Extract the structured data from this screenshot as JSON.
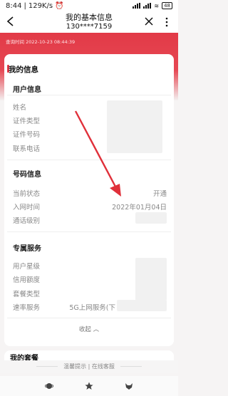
{
  "status_bar": {
    "time": "8:44",
    "speed": "129K/s",
    "battery": "48"
  },
  "header": {
    "title": "我的基本信息",
    "subtitle": "130****7159"
  },
  "query_time": "查询时间 2022-10-23 08:44:39",
  "section": {
    "title": "我的信息"
  },
  "user_info": {
    "heading": "用户信息",
    "rows": [
      {
        "label": "姓名"
      },
      {
        "label": "证件类型"
      },
      {
        "label": "证件号码"
      },
      {
        "label": "联系电话"
      }
    ]
  },
  "number_info": {
    "heading": "号码信息",
    "rows": [
      {
        "label": "当前状态",
        "value": "开通"
      },
      {
        "label": "入网时间",
        "value": "2022年01月04日"
      },
      {
        "label": "通话级别",
        "value": ""
      }
    ]
  },
  "service": {
    "heading": "专属服务",
    "rows": [
      {
        "label": "用户星级",
        "value": ""
      },
      {
        "label": "信用额度",
        "value": ""
      },
      {
        "label": "套餐类型",
        "value": ""
      },
      {
        "label": "速率服务",
        "value": "5G上网服务(下"
      }
    ]
  },
  "collapse_label": "收起",
  "next_section": {
    "title": "我的套餐"
  },
  "bottom_links": {
    "tips": "温馨提示",
    "divider": "|",
    "service": "在线客服"
  },
  "colors": {
    "accent": "#e23a47",
    "arrow": "#e0303a"
  },
  "icons": [
    "back-icon",
    "close-icon",
    "more-icon",
    "planet-icon",
    "star-icon",
    "fox-icon"
  ]
}
